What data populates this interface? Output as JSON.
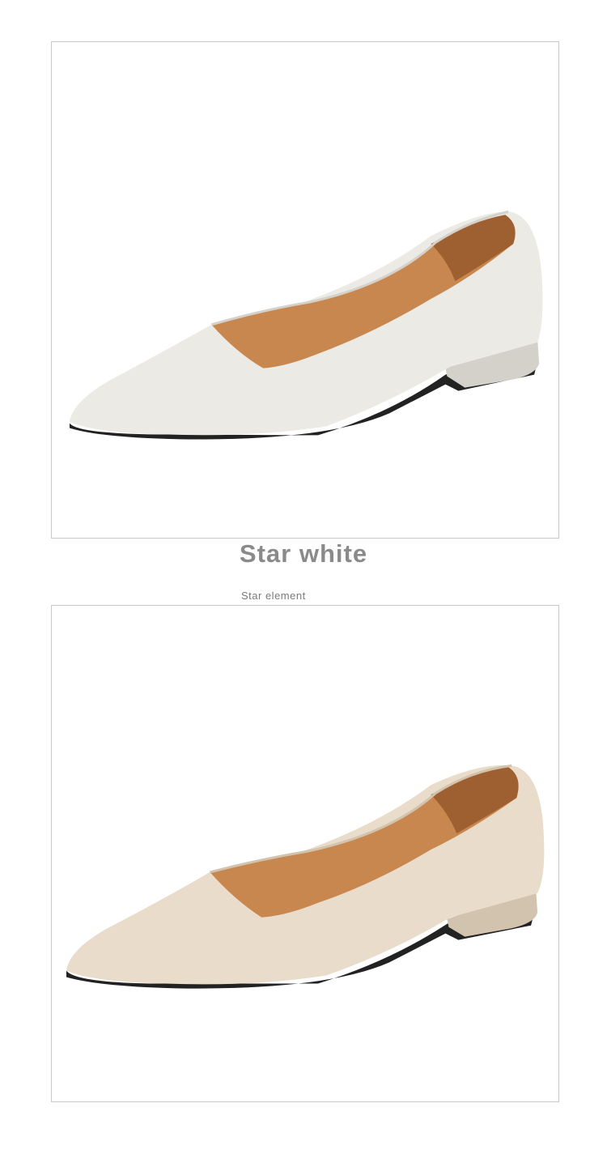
{
  "products": [
    {
      "shoe_color": "#eceae5",
      "shoe_shadow": "#d4d1cb",
      "lining_color": "#c8874f",
      "lining_dark": "#9e5f31",
      "sole_color": "#222222"
    },
    {
      "shoe_color": "#e9dccb",
      "shoe_shadow": "#d2c3ae",
      "lining_color": "#c8874f",
      "lining_dark": "#9e5f31",
      "sole_color": "#222222"
    }
  ],
  "caption": {
    "title": "Star white",
    "subtitle": "Star element"
  }
}
